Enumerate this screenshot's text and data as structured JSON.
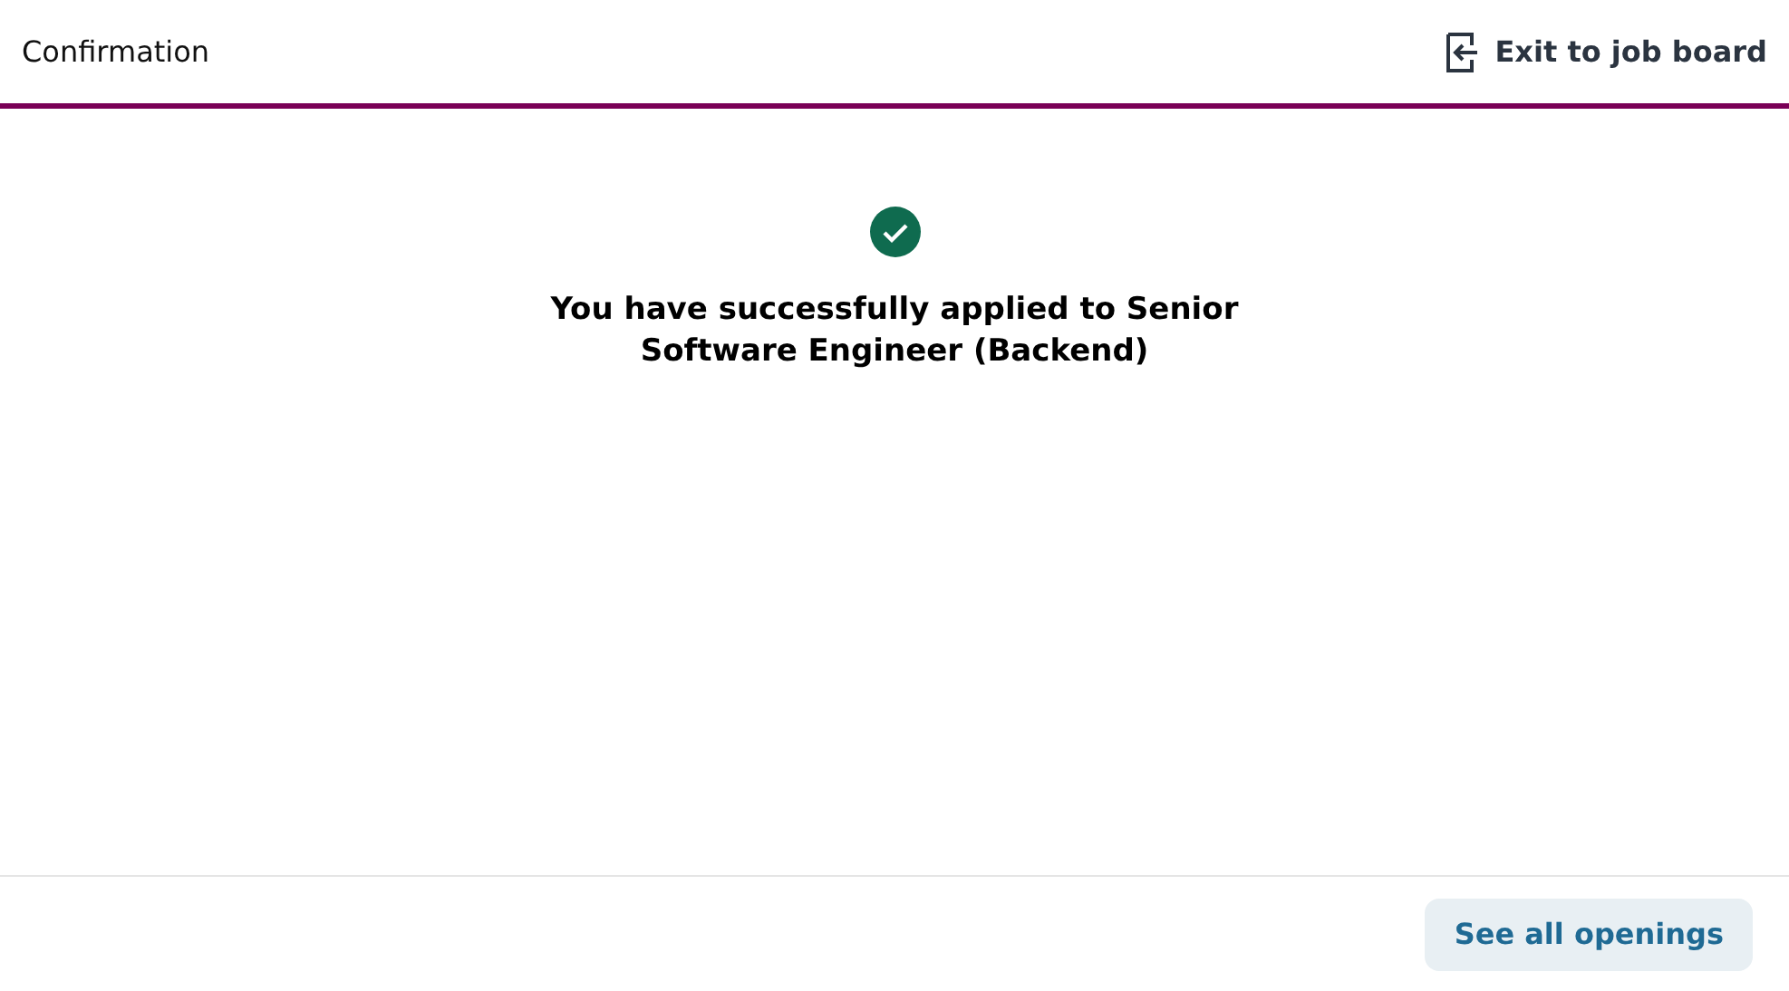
{
  "header": {
    "title": "Confirmation",
    "exit_link": "Exit to job board"
  },
  "message": {
    "succeeded": true,
    "text": "You have successfully applied to Senior Software Engineer (Backend)"
  },
  "footer": {
    "button": "See all openings"
  }
}
